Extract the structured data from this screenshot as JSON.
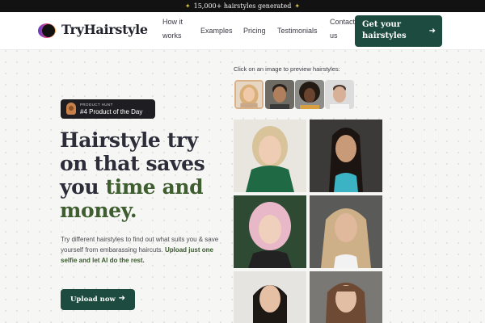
{
  "announcement": {
    "text": "15,000+ hairstyles generated",
    "icon": "sparkle-icon"
  },
  "nav": {
    "logo_text": "TryHairstyle",
    "links": [
      "How it works",
      "Examples",
      "Pricing",
      "Testimonials",
      "Contact us"
    ],
    "cta_label": "Get your hairstyles",
    "cta_icon": "arrow-right-icon"
  },
  "hero": {
    "badge_small": "PRODUCT HUNT",
    "badge_main": "#4 Product of the Day",
    "headline_plain": "Hairstyle try on that saves you",
    "headline_accent": "time and money.",
    "description": "Try different hairstyles to find out what suits you & save yourself from embarassing haircuts.",
    "description_bold": "Upload just one selfie and let AI do the rest.",
    "upload_label": "Upload now",
    "upload_icon": "arrow-right-icon"
  },
  "preview": {
    "label": "Click on an image to preview hairstyles:"
  },
  "colors": {
    "brand_green": "#1d4b3f",
    "accent_text": "#3e5e2f",
    "topbar": "#121212"
  }
}
